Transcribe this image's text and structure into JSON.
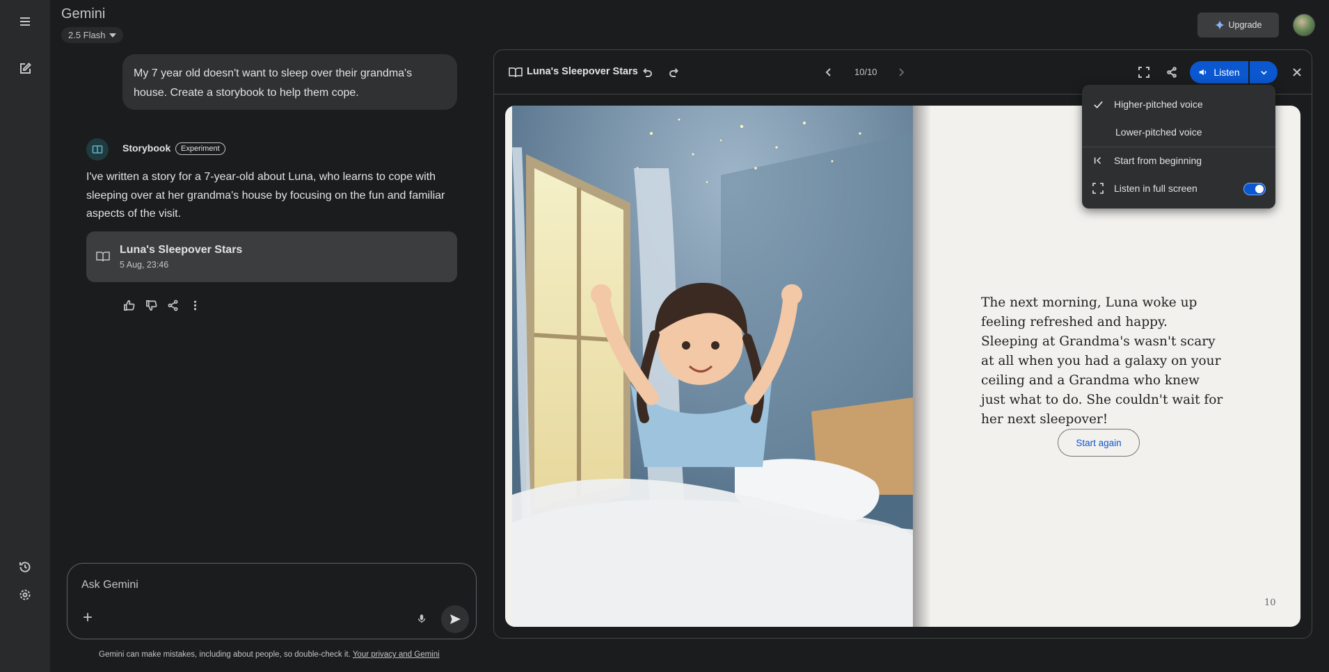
{
  "app": {
    "title": "Gemini",
    "model": "2.5 Flash"
  },
  "conversation": {
    "user_prompt": "My 7 year old doesn't want to sleep over their grandma's house. Create a storybook to help them cope.",
    "responder_name": "Storybook",
    "responder_badge": "Experiment",
    "response_text": "I've written a story for a 7-year-old about Luna, who learns to cope with sleeping over at her grandma's house by focusing on the fun and familiar aspects of the visit.",
    "story_card": {
      "title": "Luna's Sleepover Stars",
      "date": "5 Aug, 23:46"
    }
  },
  "composer": {
    "placeholder": "Ask Gemini",
    "disclaimer": "Gemini can make mistakes, including about people, so double-check it.",
    "privacy_link": "Your privacy and Gemini"
  },
  "header": {
    "upgrade_label": "Upgrade"
  },
  "canvas": {
    "title": "Luna's Sleepover Stars",
    "page_indicator": "10/10",
    "listen_label": "Listen",
    "story_text": "The next morning, Luna woke up feeling refreshed and happy. Sleeping at Grandma's wasn't scary at all when you had a galaxy on your ceiling and a Grandma who knew just what to do. She couldn't wait for her next sleepover!",
    "start_again_label": "Start again",
    "page_number": "10"
  },
  "listen_menu": {
    "items": [
      {
        "label": "Higher-pitched voice",
        "selected": true
      },
      {
        "label": "Lower-pitched voice",
        "selected": false
      },
      {
        "label": "Start from beginning"
      },
      {
        "label": "Listen in full screen",
        "toggle_on": true
      }
    ]
  },
  "colors": {
    "accent": "#0b57d0",
    "background": "#1b1c1d",
    "surface": "#282a2c"
  }
}
